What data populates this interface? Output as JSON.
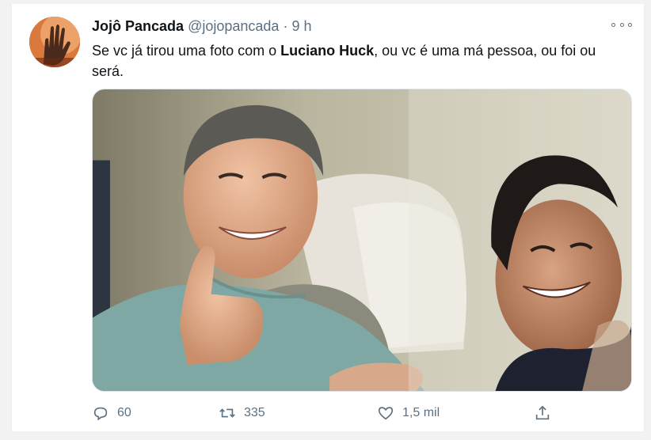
{
  "tweet": {
    "author_name": "Jojô Pancada",
    "handle": "@jojopancada",
    "separator": "·",
    "time": "9 h",
    "text_before": "Se vc já tirou uma foto com o ",
    "text_bold": "Luciano Huck",
    "text_after": ", ou vc é uma má pessoa, ou foi ou será."
  },
  "actions": {
    "reply_count": "60",
    "retweet_count": "335",
    "like_count": "1,5 mil"
  },
  "icons": {
    "avatar": "hand-photo-avatar",
    "more": "more-options-icon",
    "reply": "reply-icon",
    "retweet": "retweet-icon",
    "like": "heart-icon",
    "share": "share-icon"
  },
  "colors": {
    "secondary_text": "#5b7083",
    "primary_text": "#0f1419",
    "background": "#ffffff"
  }
}
